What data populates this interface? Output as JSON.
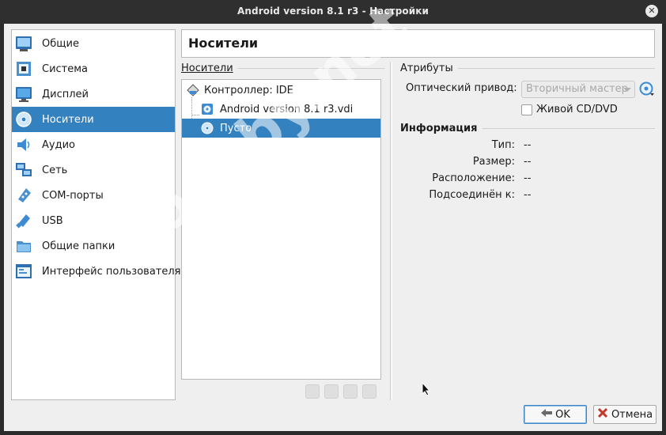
{
  "window": {
    "title": "Android version 8.1 r3 - Настройки",
    "close_glyph": "✕"
  },
  "sidebar": {
    "items": [
      {
        "label": "Общие",
        "icon": "general-icon"
      },
      {
        "label": "Система",
        "icon": "system-icon"
      },
      {
        "label": "Дисплей",
        "icon": "display-icon"
      },
      {
        "label": "Носители",
        "icon": "storage-icon",
        "active": true
      },
      {
        "label": "Аудио",
        "icon": "audio-icon"
      },
      {
        "label": "Сеть",
        "icon": "network-icon"
      },
      {
        "label": "COM-порты",
        "icon": "serial-ports-icon"
      },
      {
        "label": "USB",
        "icon": "usb-icon"
      },
      {
        "label": "Общие папки",
        "icon": "shared-folders-icon"
      },
      {
        "label": "Интерфейс пользователя",
        "icon": "user-interface-icon"
      }
    ]
  },
  "page": {
    "title": "Носители"
  },
  "storage": {
    "group_title": "Носители",
    "tree": [
      {
        "label": "Контроллер: IDE",
        "icon": "ide-controller-icon"
      },
      {
        "label": "Android version 8.1 r3.vdi",
        "icon": "hard-disk-icon"
      },
      {
        "label": "Пусто",
        "icon": "optical-disc-icon",
        "selected": true
      }
    ]
  },
  "attributes": {
    "group_title": "Атрибуты",
    "optical_drive_label": "Оптический привод:",
    "optical_drive_value": "Вторичный мастер",
    "live_cd_label": "Живой CD/DVD",
    "live_cd_checked": false
  },
  "information": {
    "group_title": "Информация",
    "type_label": "Тип:",
    "type_value": "--",
    "size_label": "Размер:",
    "size_value": "--",
    "location_label": "Расположение:",
    "location_value": "--",
    "attached_label": "Подсоединён к:",
    "attached_value": "--"
  },
  "buttons": {
    "ok": "OK",
    "cancel": "Отмена"
  },
  "watermark": "codeby.net",
  "colors": {
    "selection": "#3381be",
    "titlebar": "#2f2f2f"
  }
}
